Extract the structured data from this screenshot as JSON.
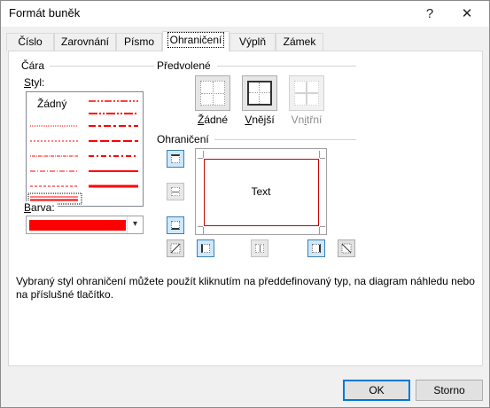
{
  "window": {
    "title": "Formát buněk",
    "help_glyph": "?",
    "close_glyph": "✕"
  },
  "tabs": [
    {
      "label": "Číslo"
    },
    {
      "label": "Zarovnání"
    },
    {
      "label": "Písmo"
    },
    {
      "label": "Ohraničení"
    },
    {
      "label": "Výplň"
    },
    {
      "label": "Zámek"
    }
  ],
  "active_tab": "Ohraničení",
  "line": {
    "group_label": "Čára",
    "style_label_pre": "S",
    "style_label_post": "tyl:",
    "none_option": "Žádný",
    "color_label_pre": "B",
    "color_label_post": "arva:",
    "selected_color": "#ff0000",
    "selected_style": "double"
  },
  "presets": {
    "group_label": "Předvolené",
    "items": [
      {
        "label_pre": "",
        "label_u": "Ž",
        "label_post": "ádné",
        "enabled": true
      },
      {
        "label_pre": "",
        "label_u": "V",
        "label_post": "nější",
        "enabled": true
      },
      {
        "label_pre": "Vn",
        "label_u": "i",
        "label_post": "třní",
        "enabled": false
      }
    ]
  },
  "border": {
    "group_label": "Ohraničení",
    "preview_text": "Text",
    "border_color": "#c80000"
  },
  "description": "Vybraný styl ohraničení můžete použít kliknutím na předdefinovaný typ, na diagram náhledu nebo na příslušné tlačítko.",
  "buttons": {
    "ok": "OK",
    "cancel": "Storno"
  }
}
